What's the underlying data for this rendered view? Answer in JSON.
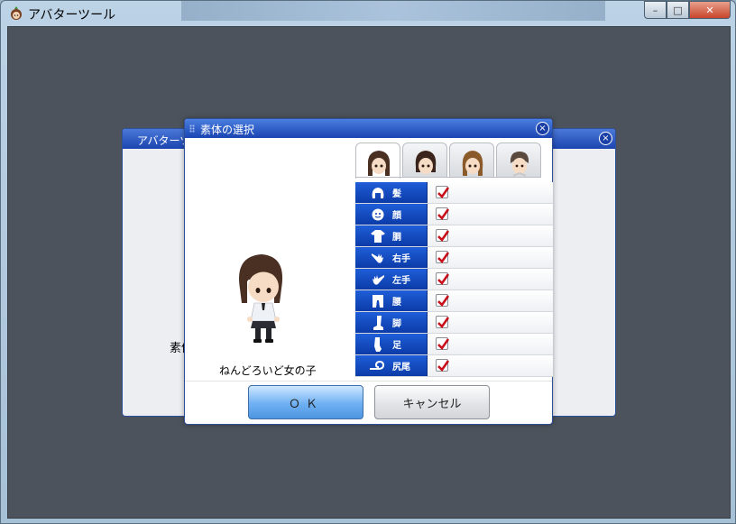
{
  "window": {
    "title": "アバターツール",
    "controls": {
      "minimize": "–",
      "maximize": "□",
      "close": "✕"
    }
  },
  "bg_dialog": {
    "title": "アバターツ",
    "close": "×",
    "text": "素体"
  },
  "dialog": {
    "title": "素体の選択",
    "close": "×",
    "tabs": [
      {
        "name": "face-tab-1",
        "hair": "#4a2f23",
        "active": true
      },
      {
        "name": "face-tab-2",
        "hair": "#3b241b",
        "active": false
      },
      {
        "name": "face-tab-3",
        "hair": "#8b5a2b",
        "active": false
      },
      {
        "name": "face-tab-4",
        "hair": "#5a4a3f",
        "active": false
      }
    ],
    "parts": [
      {
        "label": "髪",
        "icon": "hair-icon",
        "checked": true
      },
      {
        "label": "顔",
        "icon": "face-icon",
        "checked": true
      },
      {
        "label": "胴",
        "icon": "shirt-icon",
        "checked": true
      },
      {
        "label": "右手",
        "icon": "right-hand-icon",
        "checked": true
      },
      {
        "label": "左手",
        "icon": "left-hand-icon",
        "checked": true
      },
      {
        "label": "腰",
        "icon": "waist-icon",
        "checked": true
      },
      {
        "label": "脚",
        "icon": "leg-icon",
        "checked": true
      },
      {
        "label": "足",
        "icon": "foot-icon",
        "checked": true
      },
      {
        "label": "尻尾",
        "icon": "tail-icon",
        "checked": true
      }
    ],
    "preview_name": "ねんどろいど女の子",
    "ok_label": "ＯＫ",
    "cancel_label": "キャンセル"
  },
  "colors": {
    "titlebar": "#1a44b2",
    "part_label_bg": "#0b3ba8",
    "check_mark": "#c8101a",
    "ok_button": "#6fb0f3"
  }
}
